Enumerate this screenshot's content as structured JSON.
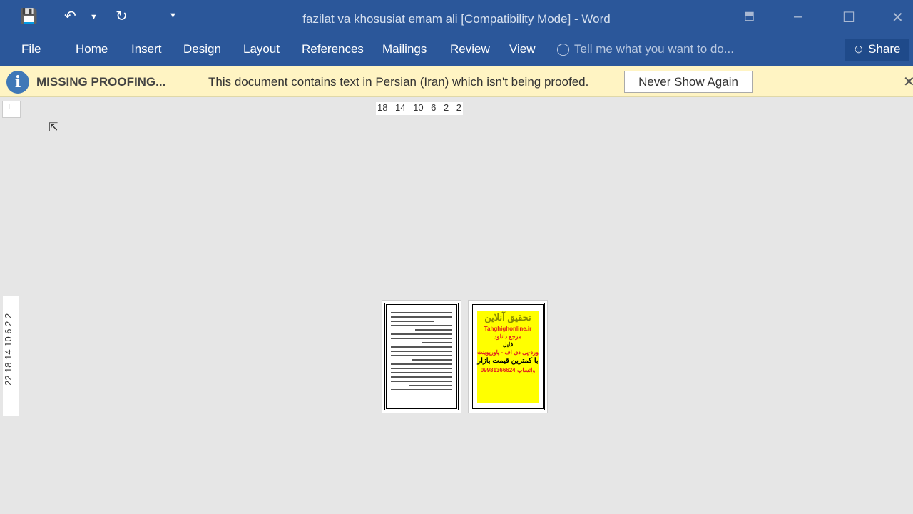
{
  "window": {
    "title": "fazilat va khosusiat emam ali [Compatibility Mode] - Word"
  },
  "qat": {
    "save": "save-icon",
    "undo": "undo-icon",
    "redo": "redo-icon",
    "customize": "customize-icon"
  },
  "ribbon": {
    "tabs": [
      "File",
      "Home",
      "Insert",
      "Design",
      "Layout",
      "References",
      "Mailings",
      "Review",
      "View"
    ],
    "tell_me": "Tell me what you want to do...",
    "share": "Share"
  },
  "message_bar": {
    "title": "MISSING PROOFING...",
    "text": "This document contains text in Persian (Iran) which isn't being proofed.",
    "button": "Never Show Again"
  },
  "ruler": {
    "horizontal": [
      "18",
      "14",
      "10",
      "6",
      "2",
      "2"
    ],
    "vertical": "22 18 14 10 6 2 2"
  },
  "ad_page": {
    "title": "تحقیق آنلاین",
    "site": "Tahghighonline.ir",
    "line1": "مرجع دانلود",
    "line2": "فایل",
    "line3": "ورد-پی دی اف - پاورپوینت",
    "line4": "با کمترین قیمت بازار",
    "phone": "09981366624",
    "whatsapp": "واتساپ"
  },
  "colors": {
    "ribbon": "#2b579a",
    "message_bar": "#fff4c3"
  }
}
